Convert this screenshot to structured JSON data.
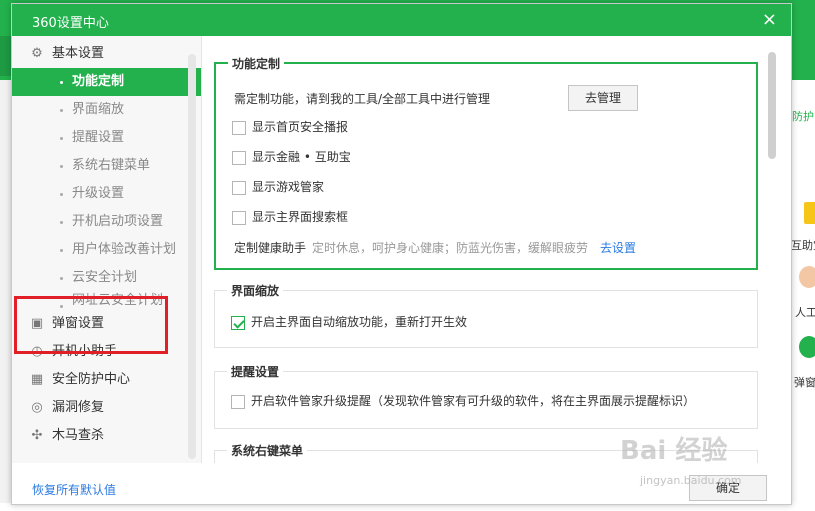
{
  "dialog": {
    "title": "360设置中心",
    "close_glyph": "×"
  },
  "sidebar": {
    "categories_top": {
      "label": "基本设置",
      "icon": "gear-icon"
    },
    "sub_items": [
      {
        "label": "功能定制",
        "active": true
      },
      {
        "label": "界面缩放"
      },
      {
        "label": "提醒设置"
      },
      {
        "label": "系统右键菜单"
      },
      {
        "label": "升级设置"
      },
      {
        "label": "开机启动项设置"
      },
      {
        "label": "用户体验改善计划"
      },
      {
        "label": "云安全计划"
      },
      {
        "label": "网址云安全计划"
      }
    ],
    "categories": [
      {
        "label": "弹窗设置",
        "icon": "window-icon"
      },
      {
        "label": "开机小助手",
        "icon": "clock-icon"
      },
      {
        "label": "安全防护中心",
        "icon": "shield-icon"
      },
      {
        "label": "漏洞修复",
        "icon": "patch-icon"
      },
      {
        "label": "木马查杀",
        "icon": "scan-icon"
      }
    ]
  },
  "content": {
    "custom": {
      "legend": "功能定制",
      "intro": "需定制功能，请到我的工具/全部工具中进行管理",
      "manage_button": "去管理",
      "options": [
        {
          "label": "显示首页安全播报",
          "checked": false
        },
        {
          "label": "显示金融 • 互助宝",
          "checked": false
        },
        {
          "label": "显示游戏管家",
          "checked": false
        },
        {
          "label": "显示主界面搜索框",
          "checked": false
        }
      ],
      "health_label": "定制健康助手",
      "health_desc": "定时休息，呵护身心健康；防蓝光伤害，缓解眼疲劳",
      "health_link": "去设置"
    },
    "zoom": {
      "legend": "界面缩放",
      "option": {
        "label": "开启主界面自动缩放功能，重新打开生效",
        "checked": true
      }
    },
    "remind": {
      "legend": "提醒设置",
      "option": {
        "label": "开启软件管家升级提醒（发现软件管家有可升级的软件，将在主界面展示提醒标识）",
        "checked": false
      }
    },
    "context_menu": {
      "legend": "系统右键菜单"
    }
  },
  "footer": {
    "restore_defaults": "恢复所有默认值",
    "ok": "确定"
  },
  "background": {
    "right_text_1": "防护",
    "right_text_2": "互助宝",
    "right_text_3": "人工",
    "right_text_4": "弹窗"
  },
  "watermark": {
    "line1": "Bai 经验",
    "line2": "jingyan.baidu.com"
  },
  "colors": {
    "brand_green": "#22b14c",
    "link_blue": "#2a7ae2",
    "annotation_red": "#e01f26"
  }
}
